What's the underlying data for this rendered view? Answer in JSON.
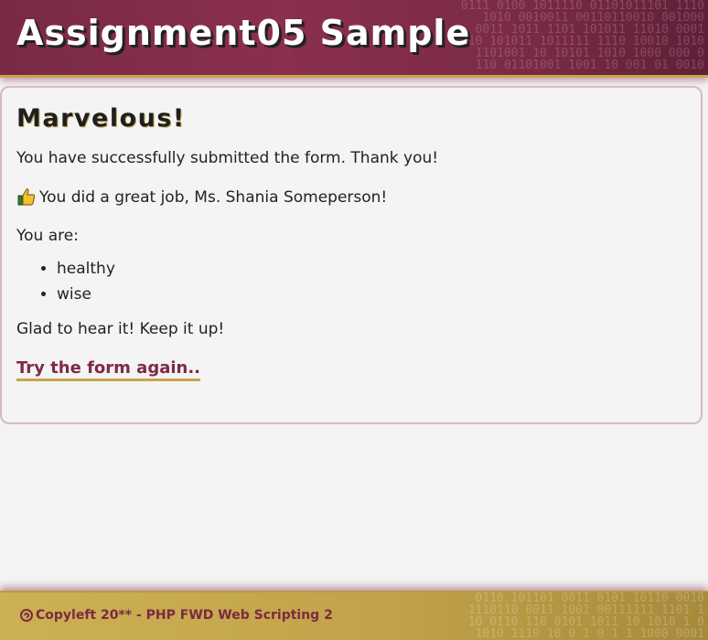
{
  "header": {
    "title": "Assignment05 Sample"
  },
  "main": {
    "heading": "Marvelous!",
    "success_message": "You have successfully submitted the form. Thank you!",
    "praise_icon": "thumbs-up-icon",
    "praise_message": "You did a great job, Ms. Shania Someperson!",
    "you_are_label": "You are:",
    "traits": [
      "healthy",
      "wise"
    ],
    "closing_message": "Glad to hear it! Keep it up!",
    "retry_link": "Try the form again.."
  },
  "footer": {
    "icon": "copyleft-icon",
    "text": "Copyleft 20** - PHP FWD Web Scripting 2"
  },
  "colors": {
    "brand": "#7a2a44",
    "accent": "#c9a54a"
  }
}
